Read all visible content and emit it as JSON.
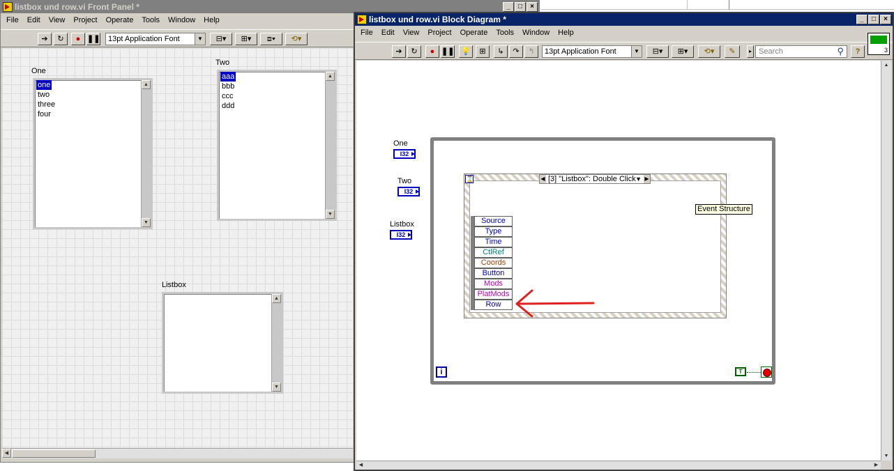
{
  "front_panel": {
    "title": "listbox und row.vi Front Panel *",
    "menu": [
      "File",
      "Edit",
      "View",
      "Project",
      "Operate",
      "Tools",
      "Window",
      "Help"
    ],
    "font": "13pt Application Font",
    "listbox_one": {
      "label": "One",
      "items": [
        "one",
        "two",
        "three",
        "four"
      ],
      "selected": 0
    },
    "listbox_two": {
      "label": "Two",
      "items": [
        "aaa",
        "bbb",
        "ccc",
        "ddd"
      ],
      "selected": 0
    },
    "listbox_three": {
      "label": "Listbox",
      "items": []
    }
  },
  "block_diagram": {
    "title": "listbox und row.vi Block Diagram *",
    "menu": [
      "File",
      "Edit",
      "View",
      "Project",
      "Operate",
      "Tools",
      "Window",
      "Help"
    ],
    "font": "13pt Application Font",
    "search_placeholder": "Search",
    "help_glyph": "?",
    "vi_icon_number": "3",
    "terminals": [
      {
        "label": "One",
        "type": "I32"
      },
      {
        "label": "Two",
        "type": "I32"
      },
      {
        "label": "Listbox",
        "type": "I32"
      }
    ],
    "event_case": "[3] \"Listbox\": Double Click",
    "event_tooltip": "Event Structure",
    "event_nodes": [
      {
        "label": "Source",
        "color": "#0000c0"
      },
      {
        "label": "Type",
        "color": "#0000c0"
      },
      {
        "label": "Time",
        "color": "#0000c0"
      },
      {
        "label": "CtlRef",
        "color": "#008080"
      },
      {
        "label": "Coords",
        "color": "#a04000"
      },
      {
        "label": "Button",
        "color": "#0000c0"
      },
      {
        "label": "Mods",
        "color": "#c000c0"
      },
      {
        "label": "PlatMods",
        "color": "#c000c0"
      },
      {
        "label": "Row",
        "color": "#0000c0"
      }
    ],
    "iteration_glyph": "i",
    "true_const": "T",
    "arrow_color": "#e02020"
  },
  "window_buttons": [
    "_",
    "□",
    "×"
  ]
}
